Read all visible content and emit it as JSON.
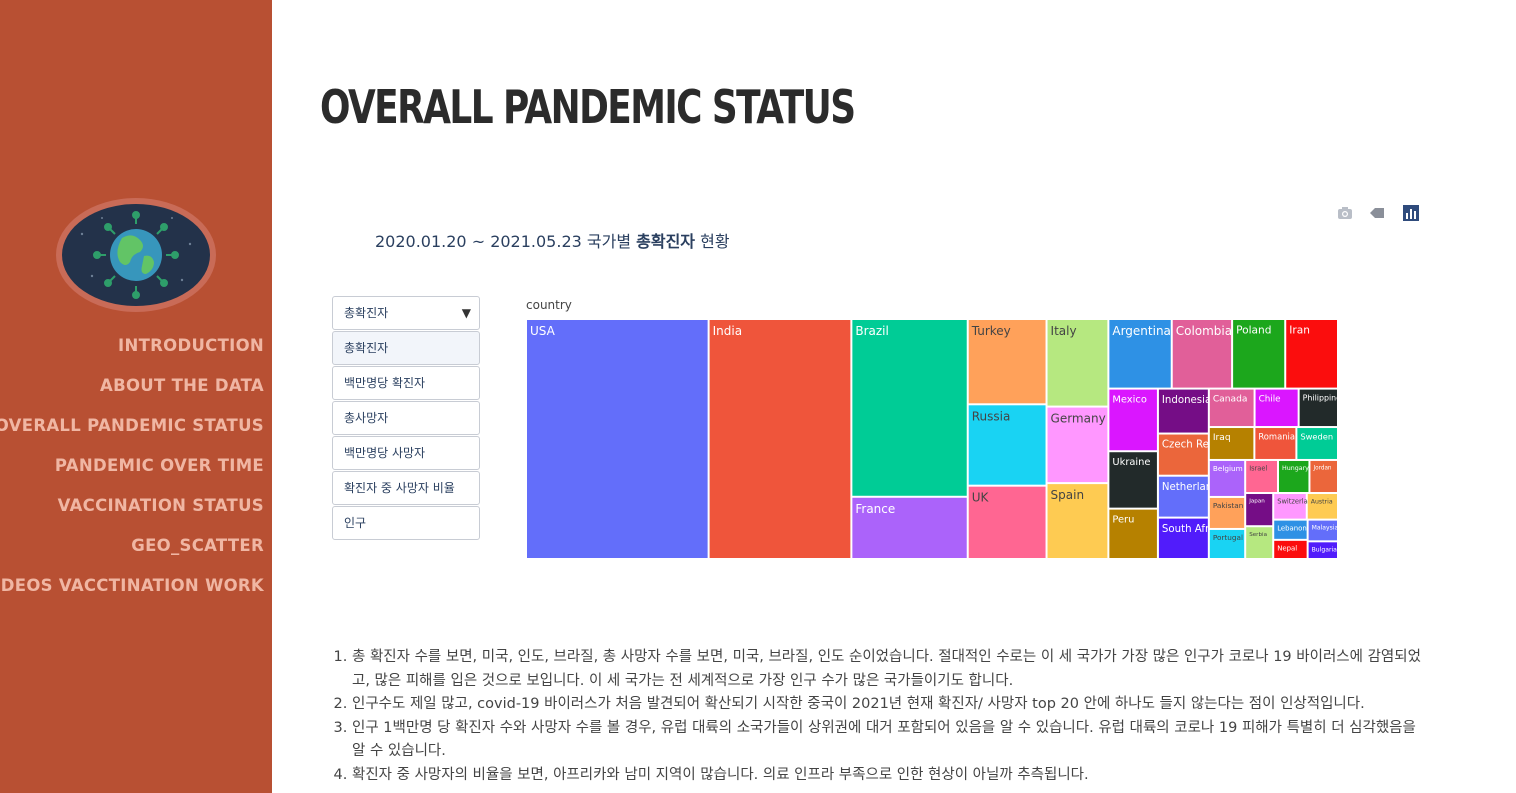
{
  "sidebar": {
    "logo": "covid-globe-logo",
    "nav": [
      "INTRODUCTION",
      "ABOUT THE DATA",
      "OVERALL PANDEMIC STATUS",
      "PANDEMIC OVER TIME",
      "VACCINATION STATUS",
      "GEO_SCATTER",
      "DEOS VACCTINATION WORK"
    ]
  },
  "page_title": "OVERALL PANDEMIC STATUS",
  "chart_header": {
    "prefix": "2020.01.20 ~ 2021.05.23 국가별 ",
    "bold": "총확진자",
    "suffix": " 현황"
  },
  "modebar": [
    "camera-icon",
    "tag-icon",
    "plotly-logo-icon"
  ],
  "dropdown": {
    "selected": "총확진자",
    "options": [
      "총확진자",
      "백만명당 확진자",
      "총사망자",
      "백만명당 사망자",
      "확진자 중 사망자 비율",
      "인구"
    ]
  },
  "colors": [
    "#636efa",
    "#ef553b",
    "#00cc96",
    "#ab63fa",
    "#ffa15a",
    "#19d3f3",
    "#ff6692",
    "#b6e880",
    "#ff97ff",
    "#fecb52",
    "#2e91e5",
    "#e15f99",
    "#1ca71c",
    "#fb0d0d",
    "#da16ff",
    "#222a2a",
    "#b68100",
    "#750d86",
    "#eb663b",
    "#511cfb"
  ],
  "chart_data": {
    "type": "treemap",
    "root": "country",
    "metric": "총확진자",
    "labels": [
      "USA",
      "India",
      "Brazil",
      "France",
      "Turkey",
      "Russia",
      "UK",
      "Italy",
      "Germany",
      "Spain",
      "Argentina",
      "Colombia",
      "Poland",
      "Iran",
      "Mexico",
      "Ukraine",
      "Peru",
      "Indonesia",
      "Czech Republic",
      "South Africa",
      "Netherlands",
      "Romania",
      "Sweden",
      "Belgium",
      "Pakistan",
      "Portugal",
      "Israel",
      "Serbia",
      "Switzerland",
      "Austria",
      "Lebanon",
      "Canada",
      "Hungary",
      "Nepal",
      "Chile",
      "Philippines",
      "Iraq",
      "Japan",
      "Jordan",
      "Bulgaria",
      "Malaysia"
    ],
    "values": [
      33900000,
      26500000,
      16000000,
      5600000,
      5200000,
      4960000,
      4470000,
      4190000,
      3660000,
      3630000,
      3410000,
      3250000,
      2860000,
      2840000,
      2400000,
      2200000,
      1930000,
      1770000,
      1660000,
      1630000,
      1650000,
      1070000,
      1060000,
      1040000,
      900000,
      845000,
      839000,
      711000,
      690000,
      643000,
      538000,
      1360000,
      804000,
      510000,
      1310000,
      1170000,
      1160000,
      720000,
      730000,
      415000,
      510000
    ]
  },
  "notes": [
    "총 확진자 수를 보면, 미국, 인도, 브라질, 총 사망자 수를 보면, 미국, 브라질, 인도 순이었습니다. 절대적인 수로는 이 세 국가가 가장 많은 인구가 코로나 19 바이러스에 감염되었고, 많은 피해를 입은 것으로 보입니다. 이 세 국가는 전 세계적으로 가장 인구 수가 많은 국가들이기도 합니다.",
    "인구수도 제일 많고, covid-19 바이러스가 처음 발견되어 확산되기 시작한 중국이 2021년 현재 확진자/ 사망자 top 20 안에 하나도 들지 않는다는 점이 인상적입니다.",
    "인구 1백만명 당 확진자 수와 사망자 수를 볼 경우, 유럽 대륙의 소국가들이 상위권에 대거 포함되어 있음을 알 수 있습니다. 유럽 대륙의 코로나 19 피해가 특별히 더 심각했음을 알 수 있습니다.",
    "확진자 중 사망자의 비율을 보면, 아프리카와 남미 지역이 많습니다. 의료 인프라 부족으로 인한 현상이 아닐까 추측됩니다."
  ]
}
